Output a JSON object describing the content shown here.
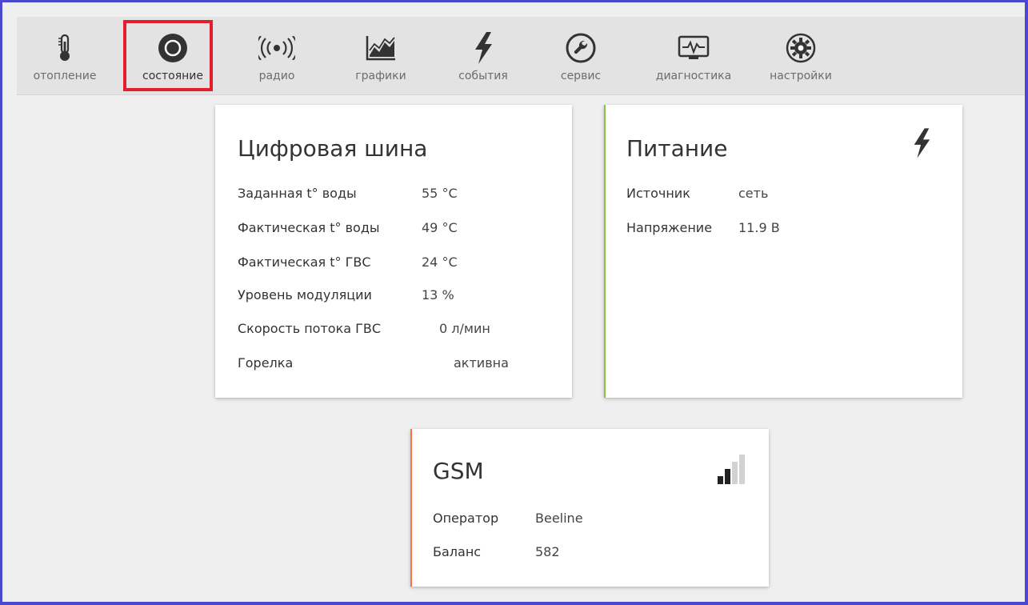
{
  "nav": {
    "items": [
      {
        "label": "отопление",
        "icon": "thermometer-icon"
      },
      {
        "label": "состояние",
        "icon": "status-circle-icon",
        "active": true
      },
      {
        "label": "радио",
        "icon": "radio-waves-icon"
      },
      {
        "label": "графики",
        "icon": "chart-icon"
      },
      {
        "label": "события",
        "icon": "lightning-icon"
      },
      {
        "label": "сервис",
        "icon": "wrench-icon"
      },
      {
        "label": "диагностика",
        "icon": "pulse-monitor-icon"
      },
      {
        "label": "настройки",
        "icon": "gear-icon"
      }
    ]
  },
  "bus": {
    "title": "Цифровая шина",
    "rows": [
      {
        "label": "Заданная t° воды",
        "value": "55 °C"
      },
      {
        "label": "Фактическая t° воды",
        "value": "49 °C"
      },
      {
        "label": "Фактическая t° ГВС",
        "value": "24 °C"
      },
      {
        "label": "Уровень модуляции",
        "value": "13 %"
      },
      {
        "label": "Скорость потока ГВС",
        "value": "0 л/мин"
      },
      {
        "label": "Горелка",
        "value": "активна"
      }
    ]
  },
  "power": {
    "title": "Питание",
    "icon": "lightning-icon",
    "rows": [
      {
        "label": "Источник",
        "value": "сеть"
      },
      {
        "label": "Напряжение",
        "value": "11.9 В"
      }
    ]
  },
  "gsm": {
    "title": "GSM",
    "icon": "signal-strength-icon",
    "signal_bars_filled": 2,
    "signal_bars_total": 4,
    "rows": [
      {
        "label": "Оператор",
        "value": "Beeline"
      },
      {
        "label": "Баланс",
        "value": "582"
      }
    ]
  },
  "colors": {
    "highlight": "#e51e2b",
    "frame": "#4a48d1",
    "power_accent": "#8bc34a",
    "gsm_accent": "#ff7043"
  }
}
